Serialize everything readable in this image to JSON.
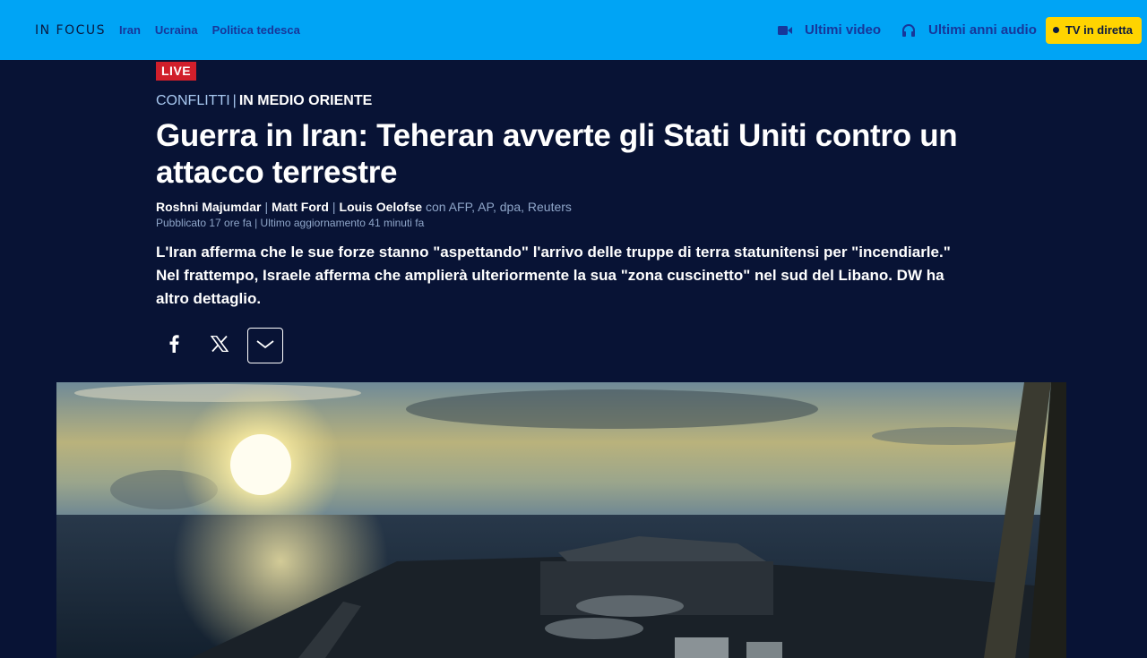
{
  "topbar": {
    "infocus": "IN FOCUS",
    "topics": [
      "Iran",
      "Ucraina",
      "Politica tedesca"
    ],
    "latest_video": "Ultimi video",
    "latest_audio": "Ultimi anni audio",
    "live_tv": "TV in diretta"
  },
  "article": {
    "live_badge": "LIVE",
    "section": "CONFLITTI",
    "section_separator": "|",
    "subsection": "IN MEDIO ORIENTE",
    "headline": "Guerra in Iran: Teheran avverte gli Stati Uniti contro un attacco terrestre",
    "authors": [
      "Roshni Majumdar",
      "Matt Ford",
      "Louis Oelofse"
    ],
    "agencies": "con AFP, AP, dpa, Reuters",
    "published": "Pubblicato 17 ore fa",
    "updated": "Ultimo aggiornamento 41 minuti fa",
    "lead": "L'Iran afferma che le sue forze stanno \"aspettando\" l'arrivo delle truppe di terra statunitensi per \"incendiarle.\" Nel frattempo, Israele afferma che amplierà ulteriormente la sua \"zona cuscinetto\" nel sud del Libano. DW ha altro dettaglio."
  },
  "share": {
    "icons": [
      "facebook-icon",
      "x-icon",
      "chevron-down-icon"
    ]
  },
  "colors": {
    "topbar_bg": "#00a4f5",
    "page_bg": "#081335",
    "live_red": "#d11f2b",
    "tv_yellow": "#ffd400",
    "link_blue": "#17379a"
  }
}
